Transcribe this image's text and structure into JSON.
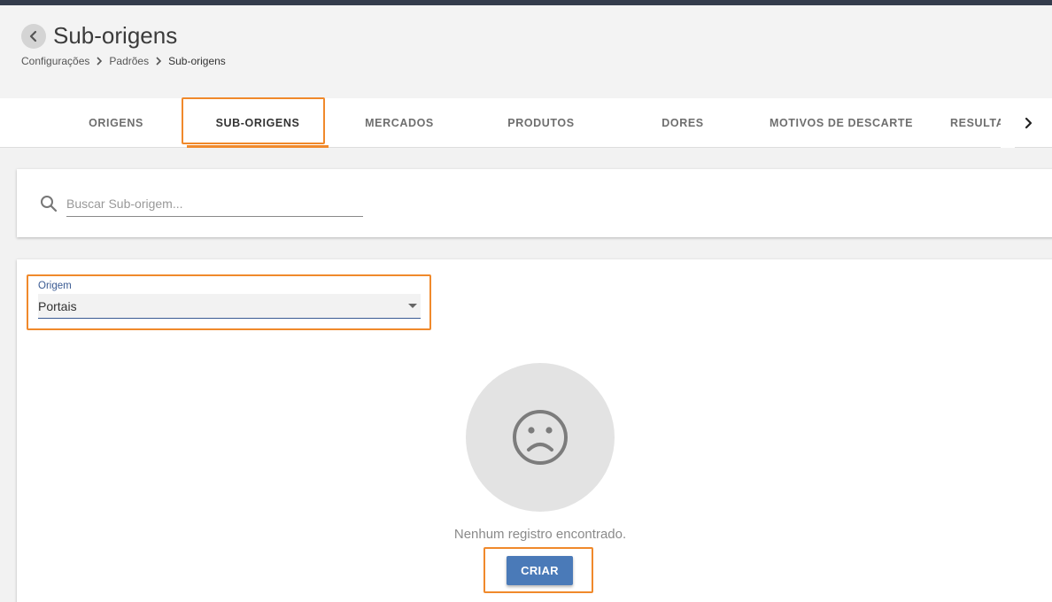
{
  "header": {
    "title": "Sub-origens",
    "breadcrumb": [
      "Configurações",
      "Padrões",
      "Sub-origens"
    ]
  },
  "tabs": [
    {
      "label": "ORIGENS",
      "active": false
    },
    {
      "label": "SUB-ORIGENS",
      "active": true
    },
    {
      "label": "MERCADOS",
      "active": false
    },
    {
      "label": "PRODUTOS",
      "active": false
    },
    {
      "label": "DORES",
      "active": false
    },
    {
      "label": "MOTIVOS DE DESCARTE",
      "active": false
    },
    {
      "label": "RESULTAD",
      "active": false
    }
  ],
  "search": {
    "placeholder": "Buscar Sub-origem...",
    "value": ""
  },
  "filter": {
    "label": "Origem",
    "selected": "Portais"
  },
  "empty_state": {
    "message": "Nenhum registro encontrado.",
    "icon": "sad-face-icon"
  },
  "actions": {
    "create_label": "CRIAR"
  },
  "colors": {
    "accent": "#f0892b",
    "primary_button": "#4a7ab8",
    "topbar": "#343c4c",
    "select_underline": "#3a5a92"
  }
}
